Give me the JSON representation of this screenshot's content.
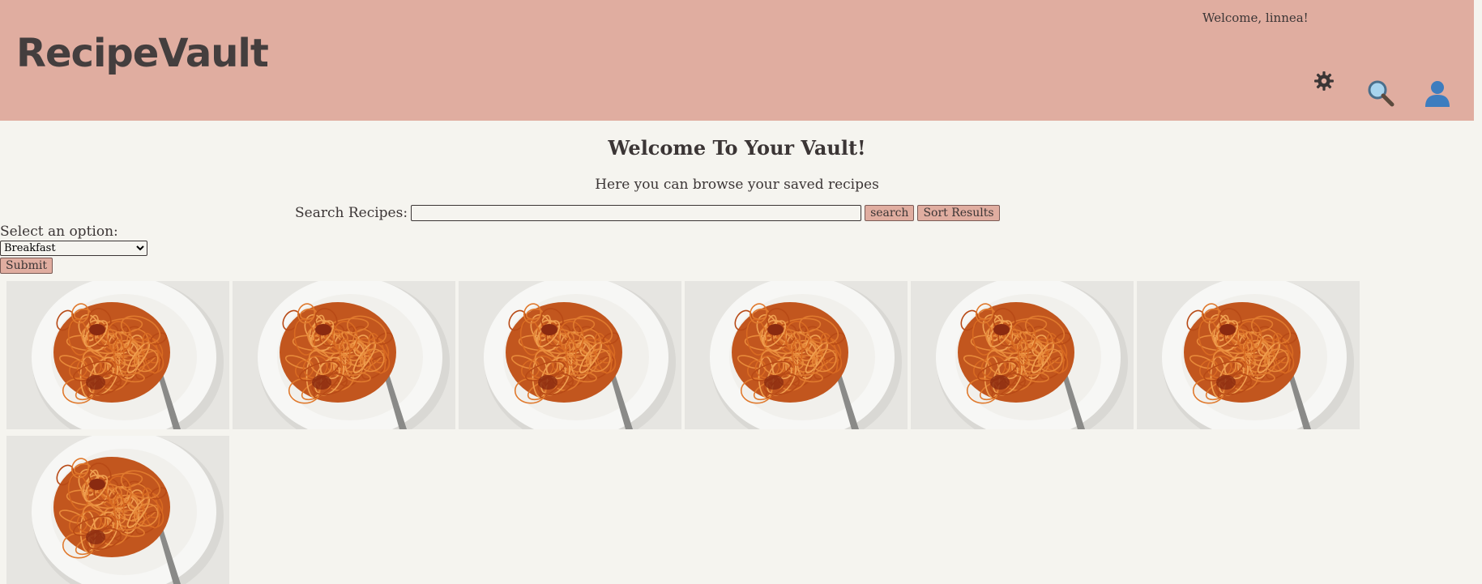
{
  "header": {
    "logo": "RecipeVault",
    "welcome": "Welcome, linnea!",
    "icons": [
      "gear-icon",
      "magnifier-icon",
      "user-icon"
    ],
    "background_color": "#e0ada0"
  },
  "main": {
    "title": "Welcome To Your Vault!",
    "subtitle": "Here you can browse your saved recipes",
    "search_label": "Search Recipes:",
    "search_value": "",
    "search_button": "search",
    "sort_button": "Sort Results",
    "select_label": "Select an option:",
    "select_value": "Breakfast",
    "submit_button": "Submit"
  },
  "recipes": [
    {
      "image": "spaghetti-plate"
    },
    {
      "image": "spaghetti-plate"
    },
    {
      "image": "spaghetti-plate"
    },
    {
      "image": "spaghetti-plate"
    },
    {
      "image": "spaghetti-plate"
    },
    {
      "image": "spaghetti-plate"
    },
    {
      "image": "spaghetti-plate"
    }
  ]
}
